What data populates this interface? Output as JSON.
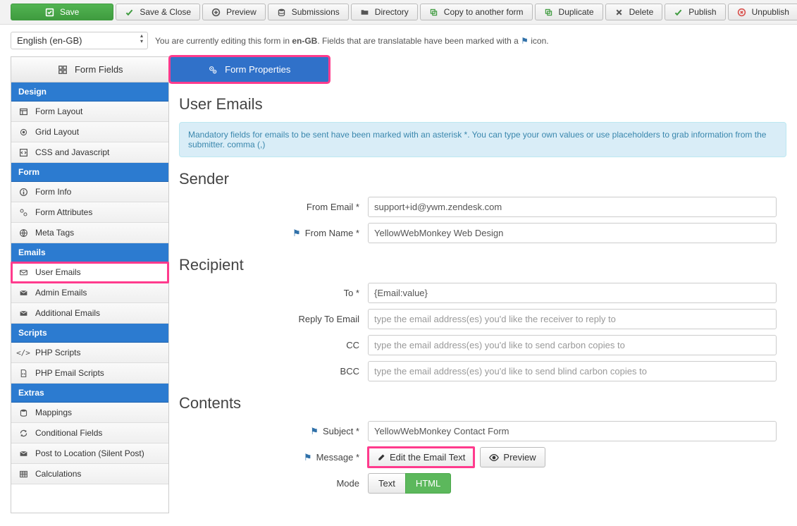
{
  "toolbar": {
    "save": "Save",
    "save_close": "Save & Close",
    "preview": "Preview",
    "submissions": "Submissions",
    "directory": "Directory",
    "copy": "Copy to another form",
    "duplicate": "Duplicate",
    "delete": "Delete",
    "publish": "Publish",
    "unpublish": "Unpublish"
  },
  "lang": {
    "selected": "English (en-GB)",
    "msg_pre": "You are currently editing this form in ",
    "msg_code": "en-GB",
    "msg_post": ". Fields that are translatable have been marked with a ",
    "msg_end": " icon."
  },
  "tabs": {
    "fields": "Form Fields",
    "properties": "Form Properties"
  },
  "sidebar": {
    "design": "Design",
    "design_items": [
      "Form Layout",
      "Grid Layout",
      "CSS and Javascript"
    ],
    "form": "Form",
    "form_items": [
      "Form Info",
      "Form Attributes",
      "Meta Tags"
    ],
    "emails": "Emails",
    "emails_items": [
      "User Emails",
      "Admin Emails",
      "Additional Emails"
    ],
    "scripts": "Scripts",
    "scripts_items": [
      "PHP Scripts",
      "PHP Email Scripts"
    ],
    "extras": "Extras",
    "extras_items": [
      "Mappings",
      "Conditional Fields",
      "Post to Location (Silent Post)",
      "Calculations"
    ]
  },
  "page": {
    "title": "User Emails",
    "alert": "Mandatory fields for emails to be sent have been marked with an asterisk *. You can type your own values or use placeholders to grab information from the submitter. comma (,)",
    "sender_h": "Sender",
    "from_email_l": "From Email *",
    "from_email_v": "support+id@ywm.zendesk.com",
    "from_name_l": "From Name *",
    "from_name_v": "YellowWebMonkey Web Design",
    "recipient_h": "Recipient",
    "to_l": "To *",
    "to_v": "{Email:value}",
    "reply_l": "Reply To Email",
    "reply_p": "type the email address(es) you'd like the receiver to reply to",
    "cc_l": "CC",
    "cc_p": "type the email address(es) you'd like to send carbon copies to",
    "bcc_l": "BCC",
    "bcc_p": "type the email address(es) you'd like to send blind carbon copies to",
    "contents_h": "Contents",
    "subject_l": "Subject *",
    "subject_v": "YellowWebMonkey Contact Form",
    "message_l": "Message *",
    "edit_btn": "Edit the Email Text",
    "preview_btn": "Preview",
    "mode_l": "Mode",
    "mode_text": "Text",
    "mode_html": "HTML"
  }
}
